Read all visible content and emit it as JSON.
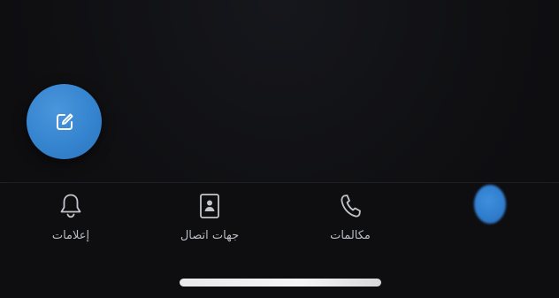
{
  "fab": {
    "icon": "compose-icon",
    "color": "#3584cf"
  },
  "tabs": [
    {
      "id": "notifications",
      "label": "إعلامات",
      "icon": "bell-icon",
      "active": false
    },
    {
      "id": "contacts",
      "label": "جهات اتصال",
      "icon": "contact-book-icon",
      "active": false
    },
    {
      "id": "calls",
      "label": "مكالمات",
      "icon": "phone-icon",
      "active": false
    },
    {
      "id": "chats",
      "label": "",
      "icon": "avatar",
      "active": true
    }
  ],
  "colors": {
    "background": "#0f0f12",
    "accent": "#3584cf",
    "tab_label": "#b9bcc3"
  }
}
